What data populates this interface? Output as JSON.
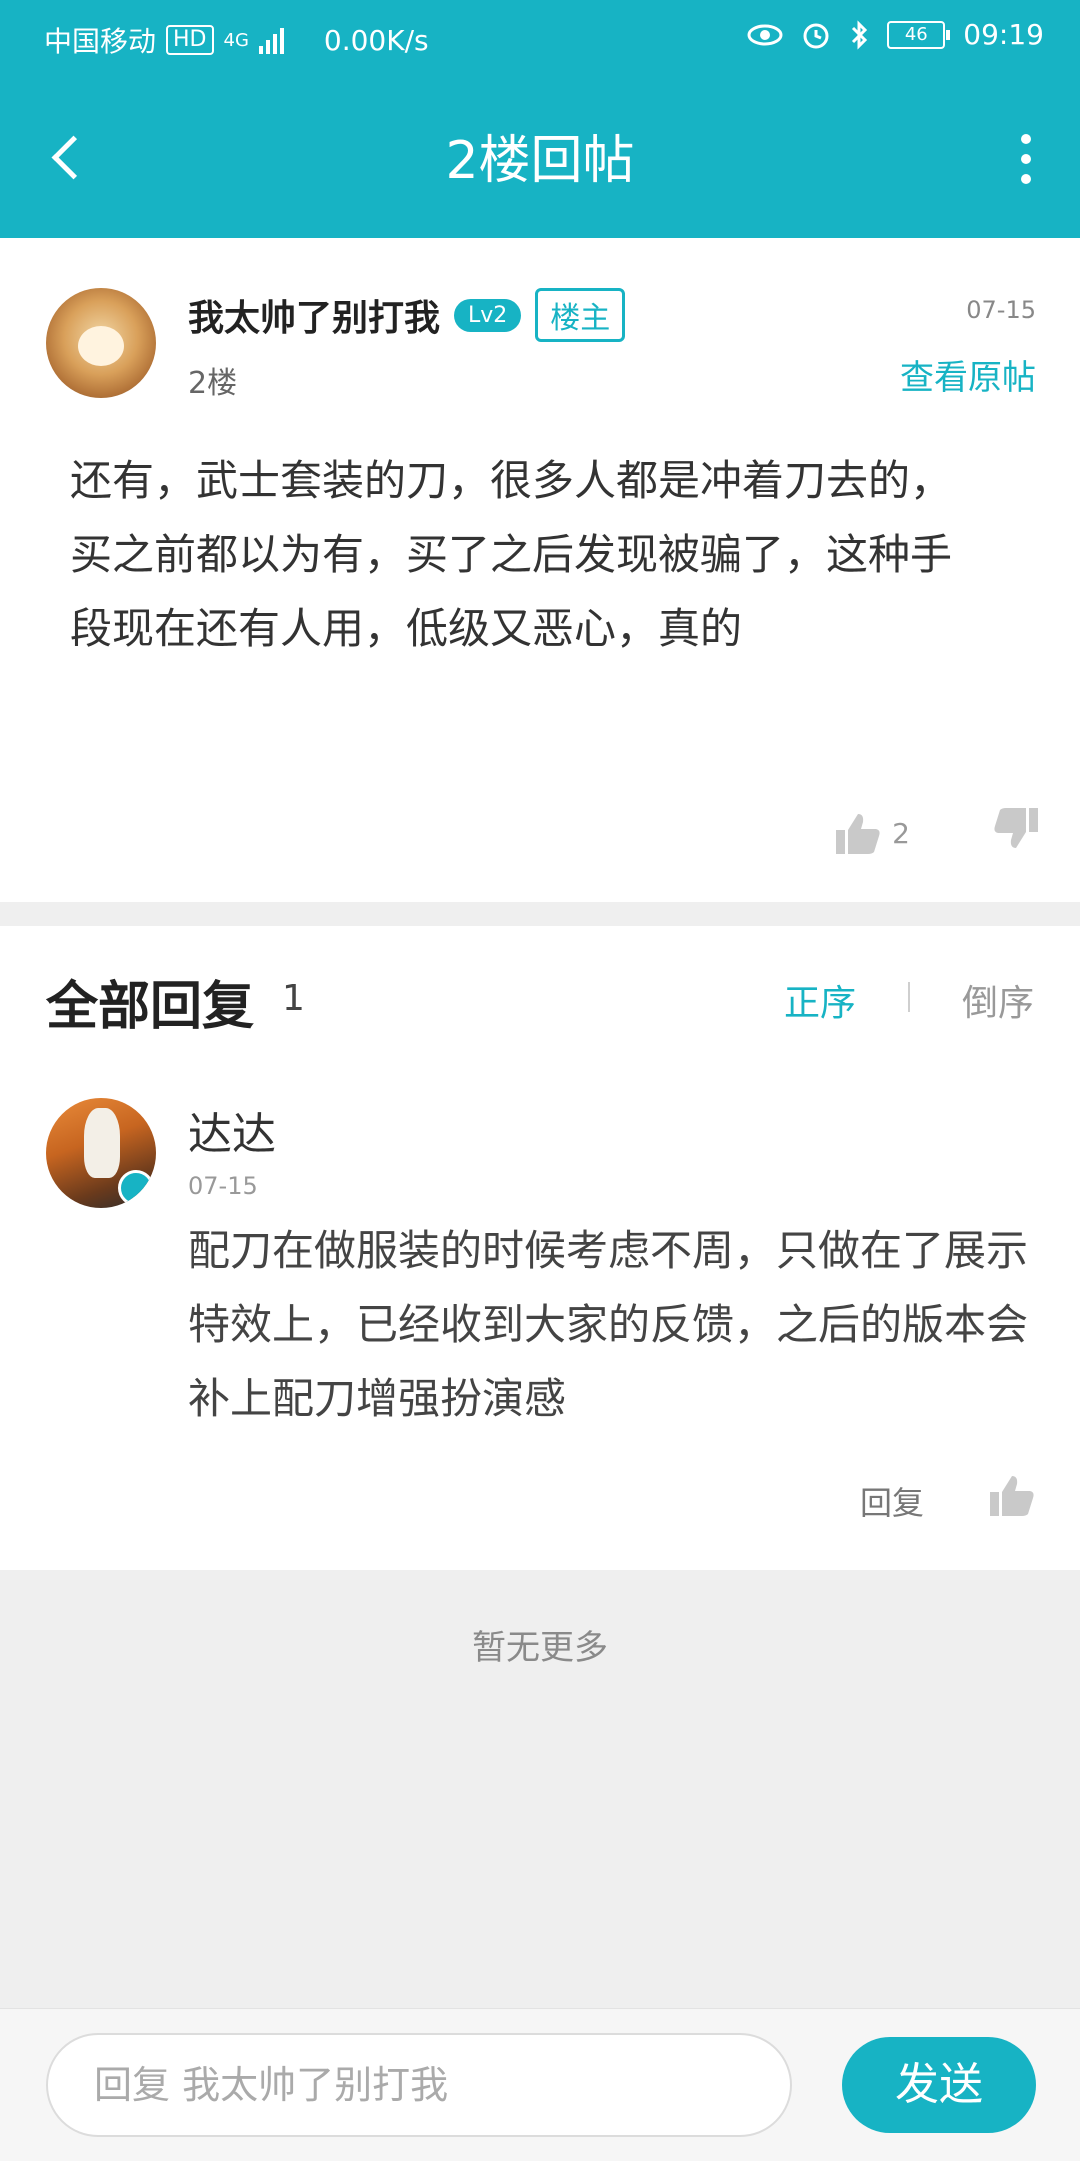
{
  "status_bar": {
    "carrier": "中国移动",
    "hd": "HD",
    "network": "4G",
    "speed": "0.00K/s",
    "battery": "46",
    "time": "09:19"
  },
  "header": {
    "title": "2楼回帖"
  },
  "post": {
    "username": "我太帅了别打我",
    "level": "Lv2",
    "op_badge": "楼主",
    "floor": "2楼",
    "date": "07-15",
    "view_original": "查看原帖",
    "content": "还有，武士套装的刀，很多人都是冲着刀去的，买之前都以为有，买了之后发现被骗了，这种手段现在还有人用，低级又恶心，真的",
    "like_count": "2"
  },
  "replies": {
    "label": "全部回复",
    "count": "1",
    "sort_asc": "正序",
    "sort_desc": "倒序",
    "items": [
      {
        "username": "达达",
        "date": "07-15",
        "content": "配刀在做服装的时候考虑不周，只做在了展示特效上，已经收到大家的反馈，之后的版本会补上配刀增强扮演感",
        "reply_label": "回复"
      }
    ]
  },
  "no_more": "暂无更多",
  "bottom": {
    "reply_placeholder": "回复 我太帅了别打我",
    "send": "发送"
  },
  "colors": {
    "accent": "#17b3c4"
  }
}
